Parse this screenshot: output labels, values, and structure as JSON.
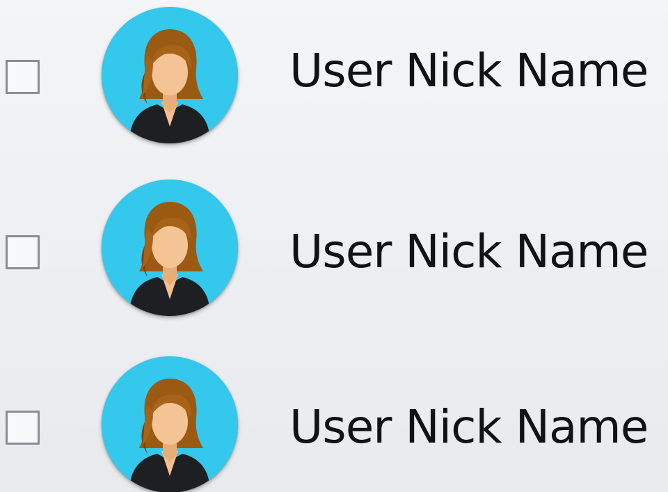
{
  "users": [
    {
      "nick_name": "User Nick Name",
      "checked": false,
      "avatar_icon": "female-user-icon"
    },
    {
      "nick_name": "User Nick Name",
      "checked": false,
      "avatar_icon": "female-user-icon"
    },
    {
      "nick_name": "User Nick Name",
      "checked": false,
      "avatar_icon": "female-user-icon"
    }
  ],
  "colors": {
    "avatar_background": "#34c8ec",
    "checkbox_border": "#8a8d92",
    "text": "#111214"
  }
}
